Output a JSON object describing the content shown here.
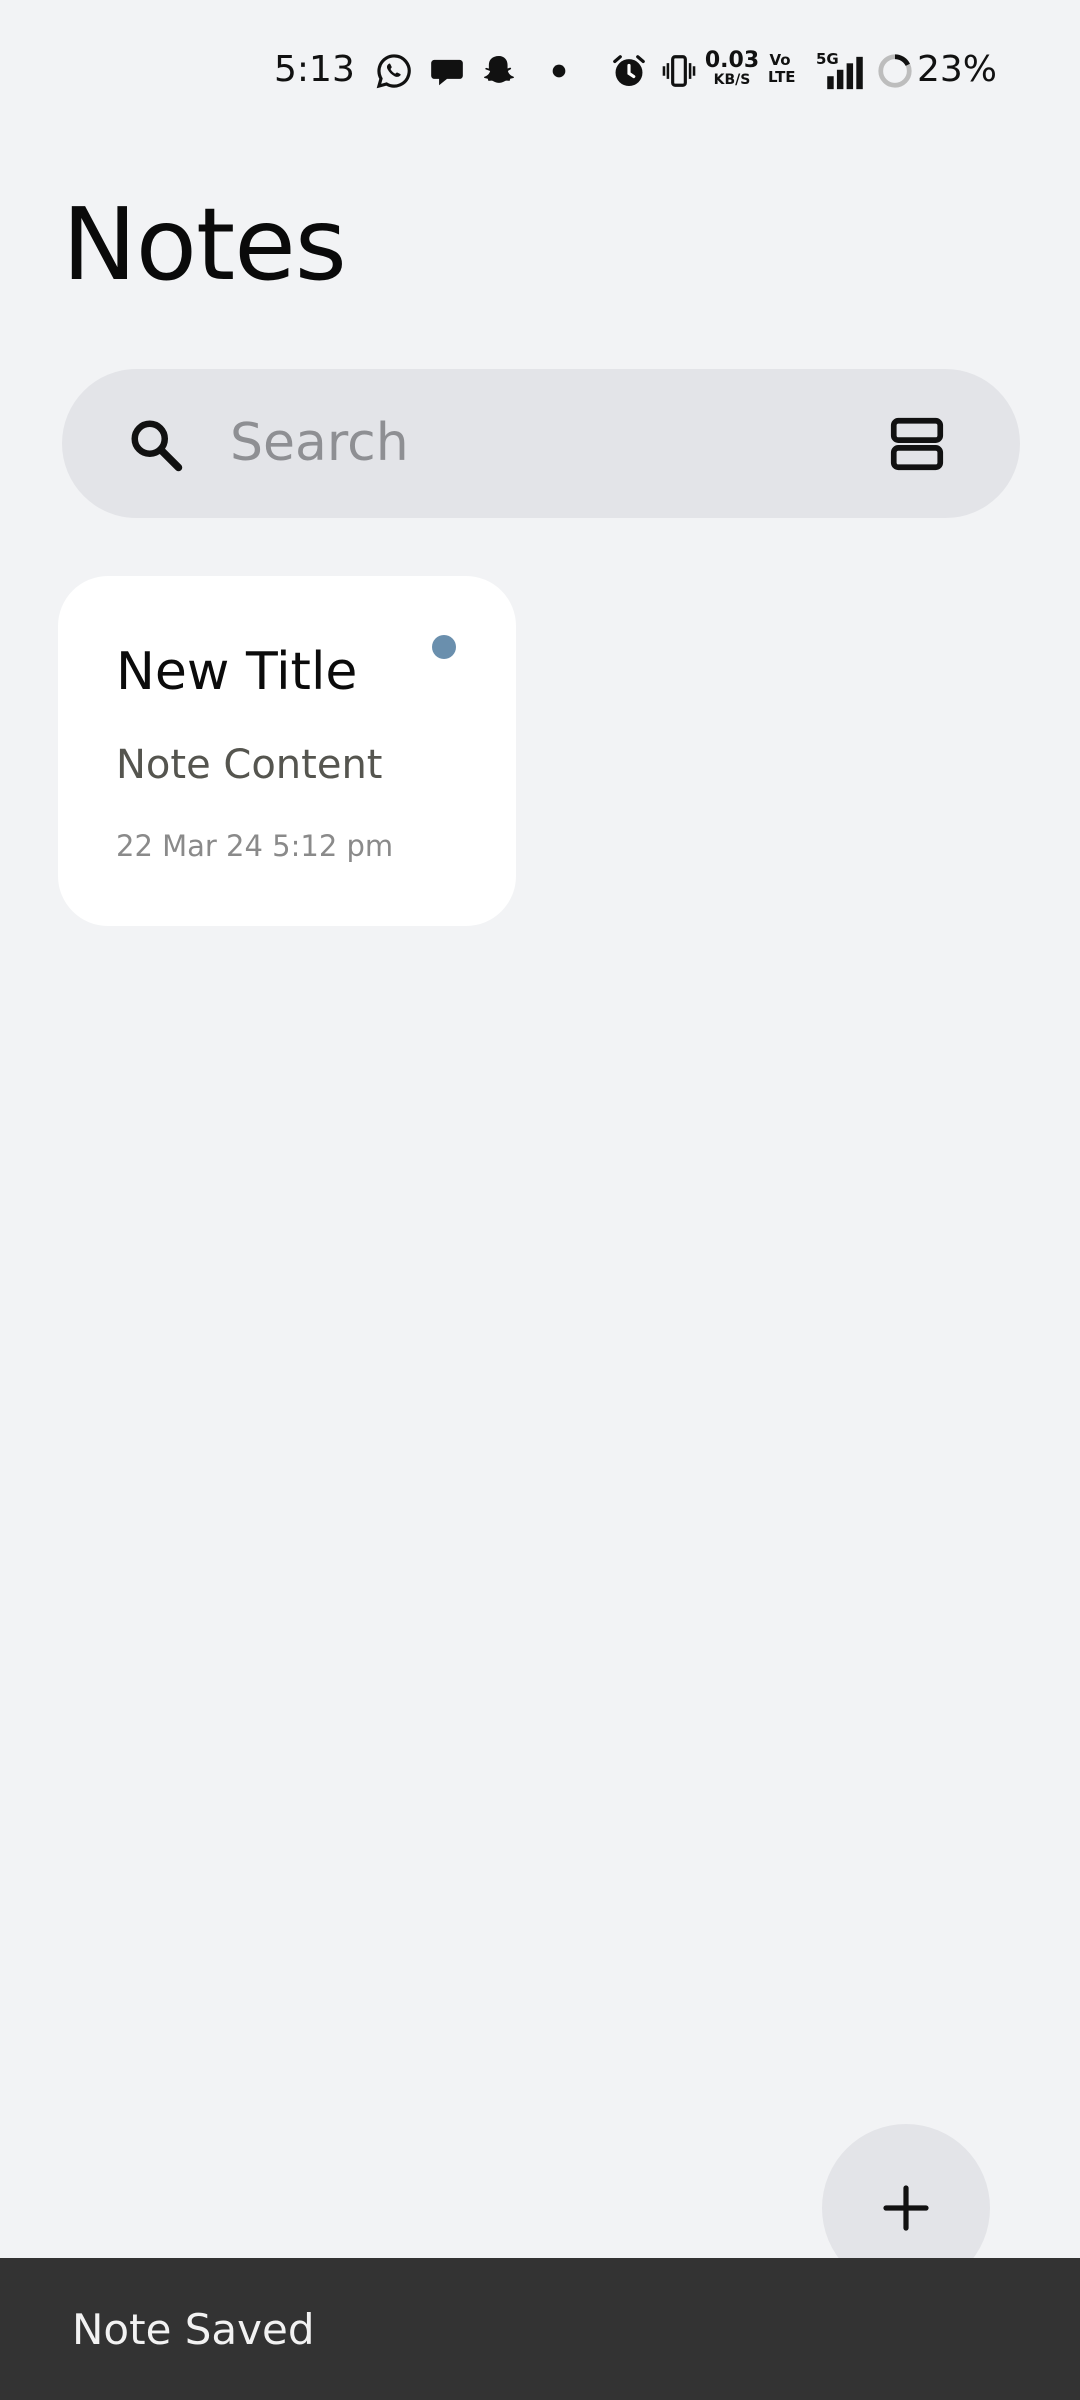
{
  "status_bar": {
    "time": "5:13",
    "net_speed_value": "0.03",
    "net_speed_unit": "KB/S",
    "volte": "Vo LTE",
    "network": "5G",
    "battery": "23%",
    "icons": [
      "whatsapp-icon",
      "chat-bubble-icon",
      "snapchat-icon",
      "notification-dot-icon",
      "alarm-icon",
      "vibrate-icon",
      "signal-icon",
      "battery-ring-icon"
    ]
  },
  "header": {
    "title": "Notes"
  },
  "search": {
    "placeholder": "Search",
    "value": ""
  },
  "notes": [
    {
      "title": "New Title",
      "content": "Note Content",
      "date": "22 Mar 24  5:12 pm",
      "color": "#6a8fad"
    }
  ],
  "fab": {
    "icon": "plus-icon"
  },
  "snackbar": {
    "message": "Note Saved"
  },
  "colors": {
    "background": "#f2f3f5",
    "search_bg": "#e3e4e8",
    "card_bg": "#ffffff",
    "snackbar_bg": "#333333"
  }
}
